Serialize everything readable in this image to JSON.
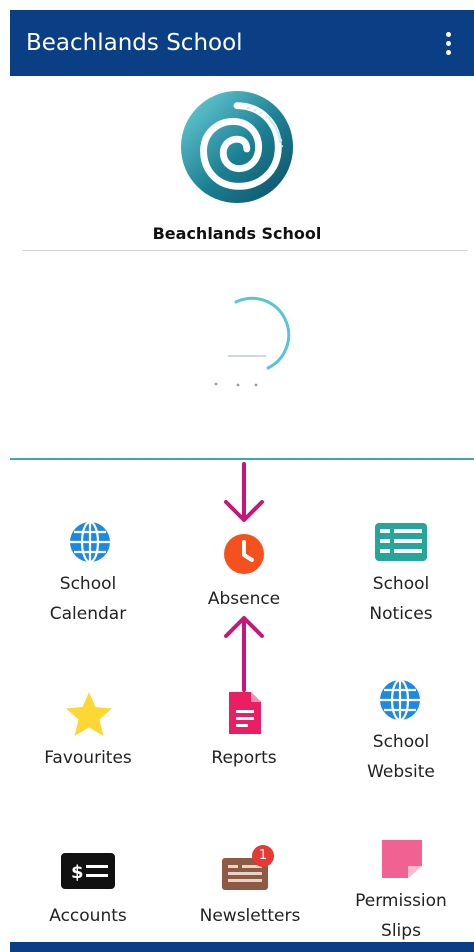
{
  "appbar": {
    "title": "Beachlands School",
    "menu_icon": "more-vertical-icon"
  },
  "school": {
    "name": "Beachlands School"
  },
  "colors": {
    "brand": "#0a3f85",
    "teal_divider": "#3aa6b9",
    "arrow": "#c2187a",
    "globe_icon": "#1e88e5",
    "absence_icon": "#f4511e",
    "notices_icon": "#26a69a",
    "star_icon": "#fdd835",
    "reports_icon": "#e91e63",
    "newsletter_icon": "#8d5a45",
    "badge": "#e53935",
    "permission_icon": "#f06292"
  },
  "tiles": [
    {
      "line1": "School",
      "line2": "Calendar",
      "icon": "globe-icon"
    },
    {
      "line1": "Absence",
      "line2": "",
      "icon": "clock-icon"
    },
    {
      "line1": "School",
      "line2": "Notices",
      "icon": "notices-icon"
    },
    {
      "line1": "Favourites",
      "line2": "",
      "icon": "star-icon"
    },
    {
      "line1": "Reports",
      "line2": "",
      "icon": "document-icon"
    },
    {
      "line1": "School",
      "line2": "Website",
      "icon": "globe-icon"
    },
    {
      "line1": "Accounts",
      "line2": "",
      "icon": "dollar-card-icon"
    },
    {
      "line1": "Newsletters",
      "line2": "",
      "icon": "newspaper-icon"
    },
    {
      "line1": "Permission",
      "line2": "Slips",
      "icon": "sticky-note-icon"
    }
  ],
  "newsletter_badge": "1"
}
